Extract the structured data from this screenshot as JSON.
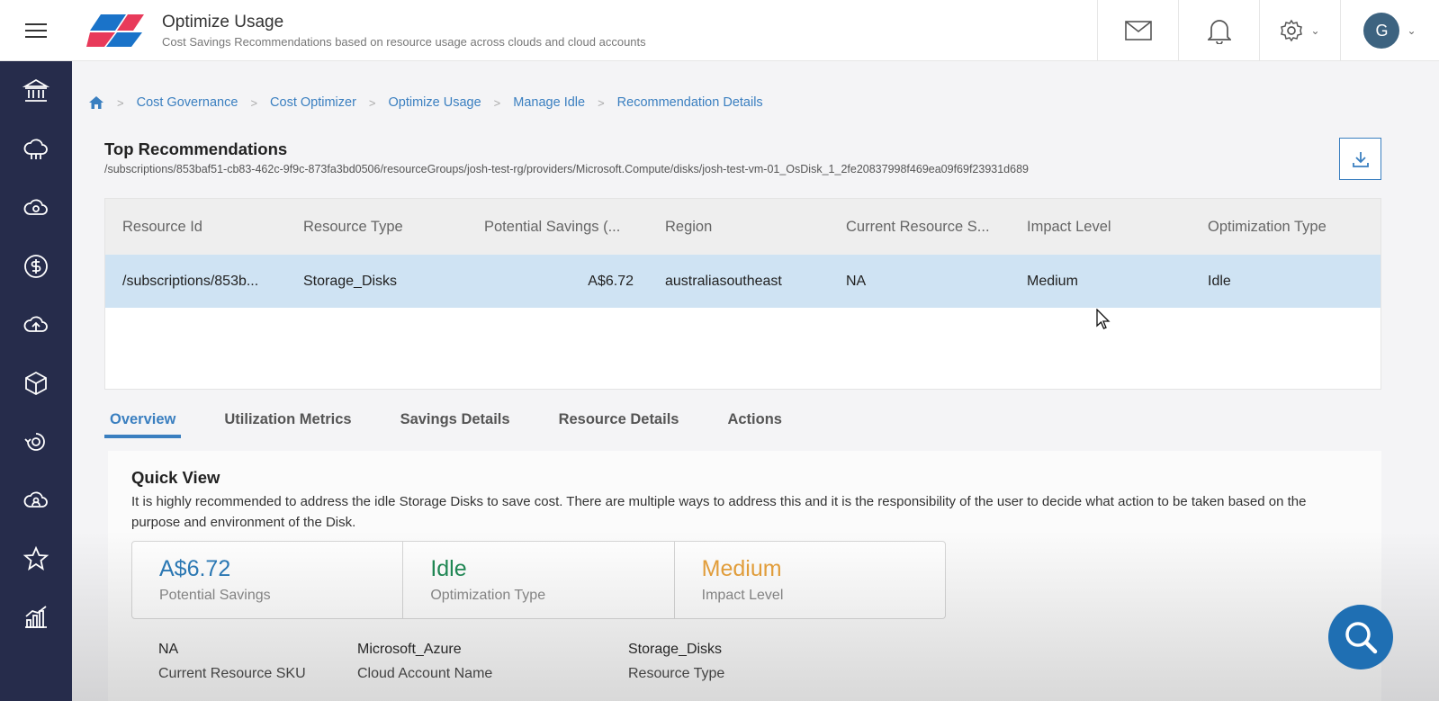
{
  "header": {
    "title": "Optimize Usage",
    "subtitle": "Cost Savings Recommendations based on resource usage across clouds and cloud accounts",
    "avatar_initial": "G",
    "brand_colors": [
      "#1a73c9",
      "#e83a5a"
    ]
  },
  "sidebar": {
    "items": [
      {
        "icon": "bank-icon"
      },
      {
        "icon": "cloud-network-icon"
      },
      {
        "icon": "cloud-sync-icon"
      },
      {
        "icon": "dollar-icon"
      },
      {
        "icon": "cloud-upload-icon"
      },
      {
        "icon": "cube-icon"
      },
      {
        "icon": "gear-cycle-icon"
      },
      {
        "icon": "cloud-user-icon"
      },
      {
        "icon": "star-icon"
      },
      {
        "icon": "chart-icon"
      }
    ]
  },
  "breadcrumb": [
    "Cost Governance",
    "Cost Optimizer",
    "Optimize Usage",
    "Manage Idle",
    "Recommendation Details"
  ],
  "section": {
    "title": "Top Recommendations",
    "path": "/subscriptions/853baf51-cb83-462c-9f9c-873fa3bd0506/resourceGroups/josh-test-rg/providers/Microsoft.Compute/disks/josh-test-vm-01_OsDisk_1_2fe20837998f469ea09f69f23931d689"
  },
  "table": {
    "columns": [
      "Resource Id",
      "Resource Type",
      "Potential Savings (...",
      "Region",
      "Current Resource S...",
      "Impact Level",
      "Optimization Type"
    ],
    "rows": [
      [
        "/subscriptions/853b...",
        "Storage_Disks",
        "A$6.72",
        "australiasoutheast",
        "NA",
        "Medium",
        "Idle"
      ]
    ]
  },
  "tabs": [
    "Overview",
    "Utilization Metrics",
    "Savings Details",
    "Resource Details",
    "Actions"
  ],
  "quick_view": {
    "title": "Quick View",
    "text": "It is highly recommended to address the idle Storage Disks to save cost. There are multiple ways to address this and it is the responsibility of the user to decide what action to be taken based on the purpose and environment of the Disk.",
    "cards": [
      {
        "value": "A$6.72",
        "label": "Potential Savings",
        "color": "#2a7ab8"
      },
      {
        "value": "Idle",
        "label": "Optimization Type",
        "color": "#1f8a55"
      },
      {
        "value": "Medium",
        "label": "Impact Level",
        "color": "#e8a13a"
      }
    ],
    "details": [
      {
        "value": "NA",
        "label": "Current Resource SKU"
      },
      {
        "value": "Microsoft_Azure",
        "label": "Cloud Account Name"
      },
      {
        "value": "Storage_Disks",
        "label": "Resource Type"
      }
    ]
  }
}
